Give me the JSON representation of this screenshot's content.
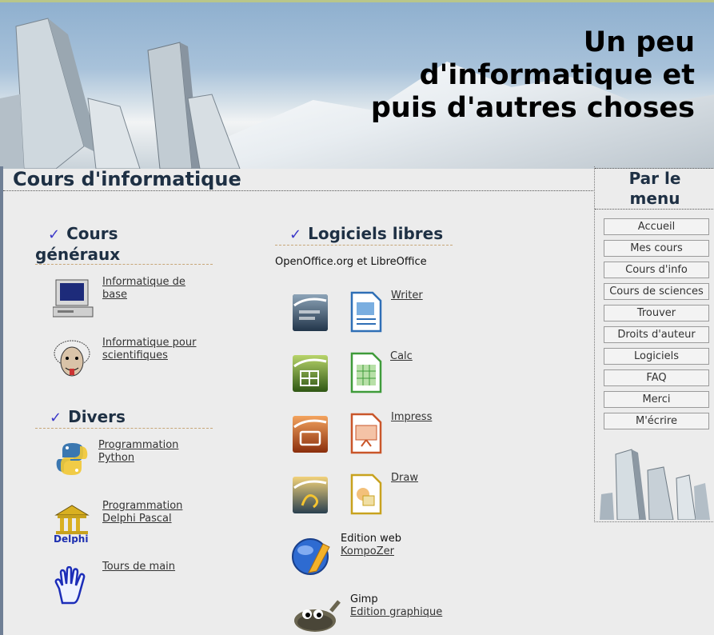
{
  "banner": {
    "title_line1": "Un peu",
    "title_line2": "d'informatique et",
    "title_line3": "puis d'autres choses"
  },
  "main": {
    "heading": "Cours d'informatique"
  },
  "cours_generaux": {
    "title_line1": "Cours",
    "title_line2": "généraux",
    "items": [
      {
        "line1": "Informatique de",
        "line2": "base",
        "icon": "computer-icon"
      },
      {
        "line1": "Informatique pour",
        "line2": "scientifiques",
        "icon": "einstein-icon"
      }
    ]
  },
  "divers": {
    "title": "Divers",
    "items": [
      {
        "line1": "Programmation",
        "line2": "Python",
        "icon": "python-icon"
      },
      {
        "line1": "Programmation",
        "line2": "Delphi Pascal",
        "icon": "delphi-icon"
      },
      {
        "line1": "Tours de main",
        "icon": "hand-icon"
      }
    ]
  },
  "logiciels": {
    "title": "Logiciels libres",
    "subtitle": "OpenOffice.org et LibreOffice",
    "apps": [
      {
        "label": "Writer",
        "color": "#2f6fb6"
      },
      {
        "label": "Calc",
        "color": "#3f9b3a"
      },
      {
        "label": "Impress",
        "color": "#c9562a"
      },
      {
        "label": "Draw",
        "color": "#c8a21e"
      }
    ],
    "web": {
      "caption": "Edition web",
      "link": "KompoZer"
    },
    "gimp": {
      "caption": "Gimp",
      "link": "Edition graphique"
    }
  },
  "sidebar": {
    "head_line1": "Par le",
    "head_line2": "menu",
    "items": [
      "Accueil",
      "Mes cours",
      "Cours d'info",
      "Cours de sciences",
      "Trouver",
      "Droits d'auteur",
      "Logiciels",
      "FAQ",
      "Merci",
      "M'écrire"
    ]
  }
}
